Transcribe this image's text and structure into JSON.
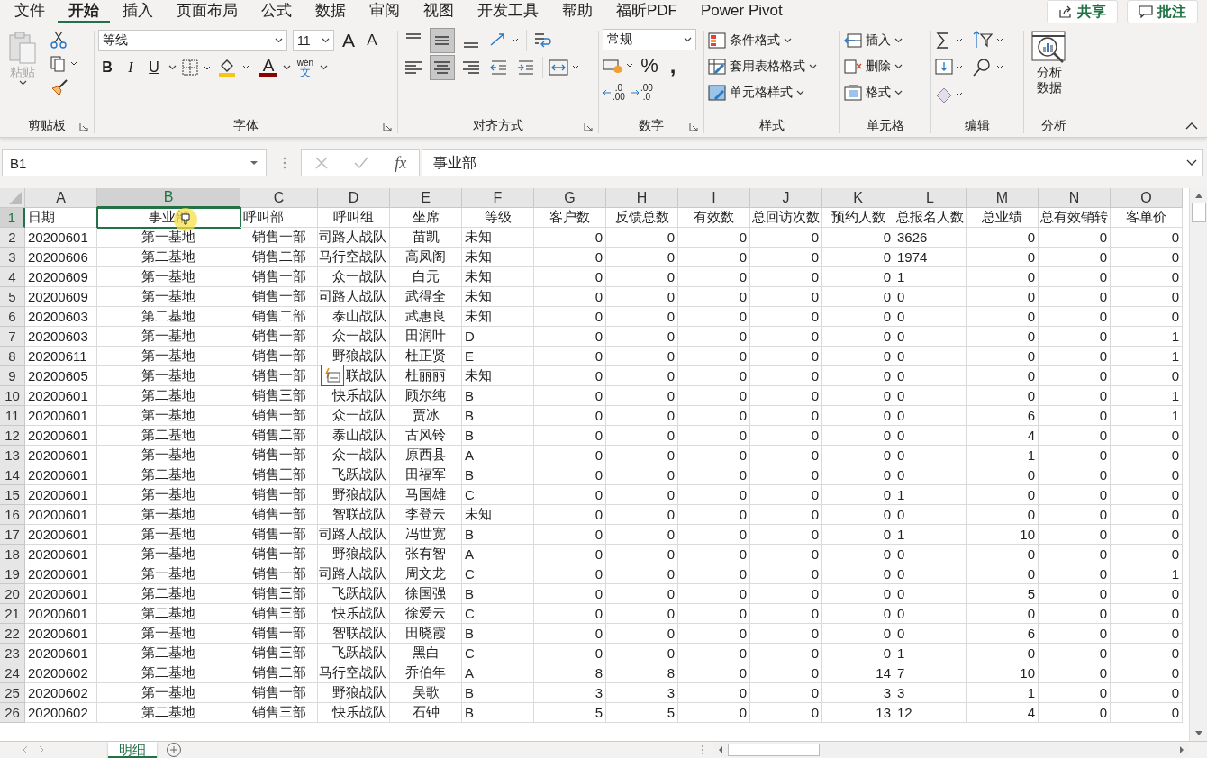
{
  "menu_tabs": [
    {
      "label": "文件",
      "selected": false
    },
    {
      "label": "开始",
      "selected": true
    },
    {
      "label": "插入",
      "selected": false
    },
    {
      "label": "页面布局",
      "selected": false
    },
    {
      "label": "公式",
      "selected": false
    },
    {
      "label": "数据",
      "selected": false
    },
    {
      "label": "审阅",
      "selected": false
    },
    {
      "label": "视图",
      "selected": false
    },
    {
      "label": "开发工具",
      "selected": false
    },
    {
      "label": "帮助",
      "selected": false
    },
    {
      "label": "福昕PDF",
      "selected": false
    },
    {
      "label": "Power Pivot",
      "selected": false
    }
  ],
  "share_button": "共享",
  "comments_button": "批注",
  "ribbon": {
    "paste": "粘贴",
    "font_name": "等线",
    "font_size": "11",
    "grow_font": "A",
    "shrink_font": "A",
    "bold": "B",
    "italic": "I",
    "underline": "U",
    "font_color": "A",
    "phonetic_top": "wén",
    "phonetic_bottom": "文",
    "number_format": "常规",
    "percent": "%",
    "comma": ",",
    "decimal_increase": [
      ".0",
      ".00"
    ],
    "decimal_decrease": [
      ".00",
      ".0"
    ],
    "conditional_format": "条件格式",
    "table_format": "套用表格格式",
    "cell_styles": "单元格样式",
    "insert": "插入",
    "delete": "删除",
    "format": "格式",
    "analyze": [
      "分析",
      "数据"
    ],
    "groups": [
      {
        "label": "剪贴板"
      },
      {
        "label": "字体"
      },
      {
        "label": "对齐方式"
      },
      {
        "label": "数字"
      },
      {
        "label": "样式"
      },
      {
        "label": "单元格"
      },
      {
        "label": "编辑"
      },
      {
        "label": "分析"
      }
    ]
  },
  "name_box": "B1",
  "fx": "fx",
  "formula": "事业部",
  "columns": [
    {
      "letter": "A",
      "selected": false
    },
    {
      "letter": "B",
      "selected": true
    },
    {
      "letter": "C",
      "selected": false
    },
    {
      "letter": "D",
      "selected": false
    },
    {
      "letter": "E",
      "selected": false
    },
    {
      "letter": "F",
      "selected": false
    },
    {
      "letter": "G",
      "selected": false
    },
    {
      "letter": "H",
      "selected": false
    },
    {
      "letter": "I",
      "selected": false
    },
    {
      "letter": "J",
      "selected": false
    },
    {
      "letter": "K",
      "selected": false
    },
    {
      "letter": "L",
      "selected": false
    },
    {
      "letter": "M",
      "selected": false
    },
    {
      "letter": "N",
      "selected": false
    },
    {
      "letter": "O",
      "selected": false
    }
  ],
  "rows": [
    {
      "number": "1",
      "selected": true,
      "cells": [
        "日期",
        "事业部",
        "呼叫部",
        "呼叫组",
        "坐席",
        "等级",
        "客户数",
        "反馈总数",
        "有效数",
        "总回访次数",
        "预约人数",
        "总报名人数",
        "总业绩",
        "总有效销转",
        "客单价"
      ]
    },
    {
      "number": "2",
      "selected": false,
      "cells": [
        "20200601",
        "第一基地",
        "销售一部",
        "司路人战队",
        "苗凯",
        "未知",
        "0",
        "0",
        "0",
        "0",
        "0",
        "3626",
        "0",
        "0",
        "0"
      ]
    },
    {
      "number": "3",
      "selected": false,
      "cells": [
        "20200606",
        "第二基地",
        "销售二部",
        "马行空战队",
        "高凤阁",
        "未知",
        "0",
        "0",
        "0",
        "0",
        "0",
        "1974",
        "0",
        "0",
        "0"
      ]
    },
    {
      "number": "4",
      "selected": false,
      "cells": [
        "20200609",
        "第一基地",
        "销售一部",
        "众一战队",
        "白元",
        "未知",
        "0",
        "0",
        "0",
        "0",
        "0",
        "1",
        "0",
        "0",
        "0"
      ]
    },
    {
      "number": "5",
      "selected": false,
      "cells": [
        "20200609",
        "第一基地",
        "销售一部",
        "司路人战队",
        "武得全",
        "未知",
        "0",
        "0",
        "0",
        "0",
        "0",
        "0",
        "0",
        "0",
        "0"
      ]
    },
    {
      "number": "6",
      "selected": false,
      "cells": [
        "20200603",
        "第二基地",
        "销售二部",
        "泰山战队",
        "武惠良",
        "未知",
        "0",
        "0",
        "0",
        "0",
        "0",
        "0",
        "0",
        "0",
        "0"
      ]
    },
    {
      "number": "7",
      "selected": false,
      "cells": [
        "20200603",
        "第一基地",
        "销售一部",
        "众一战队",
        "田润叶",
        "D",
        "0",
        "0",
        "0",
        "0",
        "0",
        "0",
        "0",
        "0",
        "1"
      ]
    },
    {
      "number": "8",
      "selected": false,
      "cells": [
        "20200611",
        "第一基地",
        "销售一部",
        "野狼战队",
        "杜正贤",
        "E",
        "0",
        "0",
        "0",
        "0",
        "0",
        "0",
        "0",
        "0",
        "1"
      ]
    },
    {
      "number": "9",
      "selected": false,
      "cells": [
        "20200605",
        "第一基地",
        "销售一部",
        "联战队",
        "杜丽丽",
        "未知",
        "0",
        "0",
        "0",
        "0",
        "0",
        "0",
        "0",
        "0",
        "0"
      ]
    },
    {
      "number": "10",
      "selected": false,
      "cells": [
        "20200601",
        "第二基地",
        "销售三部",
        "快乐战队",
        "顾尔纯",
        "B",
        "0",
        "0",
        "0",
        "0",
        "0",
        "0",
        "0",
        "0",
        "1"
      ]
    },
    {
      "number": "11",
      "selected": false,
      "cells": [
        "20200601",
        "第一基地",
        "销售一部",
        "众一战队",
        "贾冰",
        "B",
        "0",
        "0",
        "0",
        "0",
        "0",
        "0",
        "6",
        "0",
        "1"
      ]
    },
    {
      "number": "12",
      "selected": false,
      "cells": [
        "20200601",
        "第二基地",
        "销售二部",
        "泰山战队",
        "古风铃",
        "B",
        "0",
        "0",
        "0",
        "0",
        "0",
        "0",
        "4",
        "0",
        "0"
      ]
    },
    {
      "number": "13",
      "selected": false,
      "cells": [
        "20200601",
        "第一基地",
        "销售一部",
        "众一战队",
        "原西县",
        "A",
        "0",
        "0",
        "0",
        "0",
        "0",
        "0",
        "1",
        "0",
        "0"
      ]
    },
    {
      "number": "14",
      "selected": false,
      "cells": [
        "20200601",
        "第二基地",
        "销售三部",
        "飞跃战队",
        "田福军",
        "B",
        "0",
        "0",
        "0",
        "0",
        "0",
        "0",
        "0",
        "0",
        "0"
      ]
    },
    {
      "number": "15",
      "selected": false,
      "cells": [
        "20200601",
        "第一基地",
        "销售一部",
        "野狼战队",
        "马国雄",
        "C",
        "0",
        "0",
        "0",
        "0",
        "0",
        "1",
        "0",
        "0",
        "0"
      ]
    },
    {
      "number": "16",
      "selected": false,
      "cells": [
        "20200601",
        "第一基地",
        "销售一部",
        "智联战队",
        "李登云",
        "未知",
        "0",
        "0",
        "0",
        "0",
        "0",
        "0",
        "0",
        "0",
        "0"
      ]
    },
    {
      "number": "17",
      "selected": false,
      "cells": [
        "20200601",
        "第一基地",
        "销售一部",
        "司路人战队",
        "冯世宽",
        "B",
        "0",
        "0",
        "0",
        "0",
        "0",
        "1",
        "10",
        "0",
        "0"
      ]
    },
    {
      "number": "18",
      "selected": false,
      "cells": [
        "20200601",
        "第一基地",
        "销售一部",
        "野狼战队",
        "张有智",
        "A",
        "0",
        "0",
        "0",
        "0",
        "0",
        "0",
        "0",
        "0",
        "0"
      ]
    },
    {
      "number": "19",
      "selected": false,
      "cells": [
        "20200601",
        "第一基地",
        "销售一部",
        "司路人战队",
        "周文龙",
        "C",
        "0",
        "0",
        "0",
        "0",
        "0",
        "0",
        "0",
        "0",
        "1"
      ]
    },
    {
      "number": "20",
      "selected": false,
      "cells": [
        "20200601",
        "第二基地",
        "销售三部",
        "飞跃战队",
        "徐国强",
        "B",
        "0",
        "0",
        "0",
        "0",
        "0",
        "0",
        "5",
        "0",
        "0"
      ]
    },
    {
      "number": "21",
      "selected": false,
      "cells": [
        "20200601",
        "第二基地",
        "销售三部",
        "快乐战队",
        "徐爱云",
        "C",
        "0",
        "0",
        "0",
        "0",
        "0",
        "0",
        "0",
        "0",
        "0"
      ]
    },
    {
      "number": "22",
      "selected": false,
      "cells": [
        "20200601",
        "第一基地",
        "销售一部",
        "智联战队",
        "田晓霞",
        "B",
        "0",
        "0",
        "0",
        "0",
        "0",
        "0",
        "6",
        "0",
        "0"
      ]
    },
    {
      "number": "23",
      "selected": false,
      "cells": [
        "20200601",
        "第二基地",
        "销售三部",
        "飞跃战队",
        "黑白",
        "C",
        "0",
        "0",
        "0",
        "0",
        "0",
        "1",
        "0",
        "0",
        "0"
      ]
    },
    {
      "number": "24",
      "selected": false,
      "cells": [
        "20200602",
        "第二基地",
        "销售二部",
        "马行空战队",
        "乔伯年",
        "A",
        "8",
        "8",
        "0",
        "0",
        "14",
        "7",
        "10",
        "0",
        "0"
      ]
    },
    {
      "number": "25",
      "selected": false,
      "cells": [
        "20200602",
        "第一基地",
        "销售一部",
        "野狼战队",
        "吴歌",
        "B",
        "3",
        "3",
        "0",
        "0",
        "3",
        "3",
        "1",
        "0",
        "0"
      ]
    },
    {
      "number": "26",
      "selected": false,
      "cells": [
        "20200602",
        "第二基地",
        "销售三部",
        "快乐战队",
        "石钟",
        "B",
        "5",
        "5",
        "0",
        "0",
        "13",
        "12",
        "4",
        "0",
        "0"
      ]
    }
  ],
  "sheet_tabs": [
    {
      "label": "明细",
      "selected": true
    }
  ]
}
